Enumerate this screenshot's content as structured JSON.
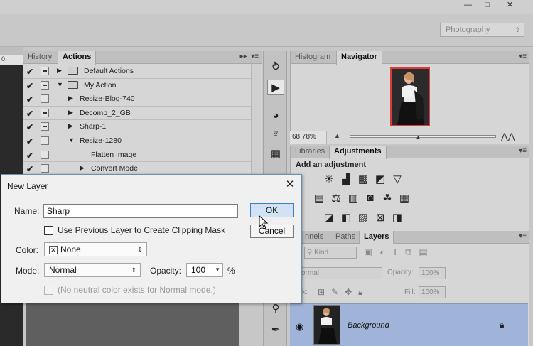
{
  "window": {
    "minimize_glyph": "—",
    "maximize_glyph": "□",
    "close_glyph": "✕",
    "workspace": "Photography"
  },
  "ruler_text": "0,",
  "actions_panel": {
    "tabs": [
      "History",
      "Actions"
    ],
    "rows": [
      {
        "check": "✔",
        "dialog": true,
        "indent": 0,
        "expanded": false,
        "folder": true,
        "label": "Default Actions"
      },
      {
        "check": "✔",
        "dialog": true,
        "indent": 0,
        "expanded": true,
        "folder": true,
        "label": "My Action"
      },
      {
        "check": "✔",
        "dialog": false,
        "indent": 1,
        "expanded": false,
        "folder": false,
        "label": "Resize-Blog-740"
      },
      {
        "check": "✔",
        "dialog": true,
        "indent": 1,
        "expanded": false,
        "folder": false,
        "label": "Decomp_2_GB"
      },
      {
        "check": "✔",
        "dialog": true,
        "indent": 1,
        "expanded": false,
        "folder": false,
        "label": "Sharp-1"
      },
      {
        "check": "✔",
        "dialog": false,
        "indent": 1,
        "expanded": true,
        "folder": false,
        "label": "Resize-1280"
      },
      {
        "check": "✔",
        "dialog": false,
        "indent": 2,
        "expanded": null,
        "folder": false,
        "label": "Flatten Image"
      },
      {
        "check": "✔",
        "dialog": false,
        "indent": 2,
        "expanded": false,
        "folder": false,
        "label": "Convert Mode"
      }
    ]
  },
  "nav_panel": {
    "tabs": [
      "Histogram",
      "Navigator"
    ],
    "zoom": "68,78%"
  },
  "adjust_panel": {
    "tabs": [
      "Libraries",
      "Adjustments"
    ],
    "title": "Add an adjustment"
  },
  "layers_panel": {
    "tabs": [
      "nnels",
      "Paths",
      "Layers"
    ],
    "filter": "Kind",
    "blend": "ormal",
    "opacity_label": "Opacity:",
    "opacity": "100%",
    "lock_label": "ck:",
    "fill_label": "Fill:",
    "fill": "100%",
    "layer_name": "Background"
  },
  "dialog": {
    "title": "New Layer",
    "name_label": "Name:",
    "name_value": "Sharp",
    "ok": "OK",
    "cancel": "Cancel",
    "clipping_label": "Use Previous Layer to Create Clipping Mask",
    "color_label": "Color:",
    "color_value": "None",
    "color_x": "✕",
    "mode_label": "Mode:",
    "mode_value": "Normal",
    "opacity_label": "Opacity:",
    "opacity_value": "100",
    "percent": "%",
    "neutral_label": "(No neutral color exists for Normal mode.)"
  },
  "colors": {
    "dialog_border": "#6e8fb5",
    "ok_fill": "#d0e2f4",
    "ok_border": "#3c7fc4",
    "layer_selected": "#9fb4d8",
    "nav_frame": "#d93a3a"
  }
}
